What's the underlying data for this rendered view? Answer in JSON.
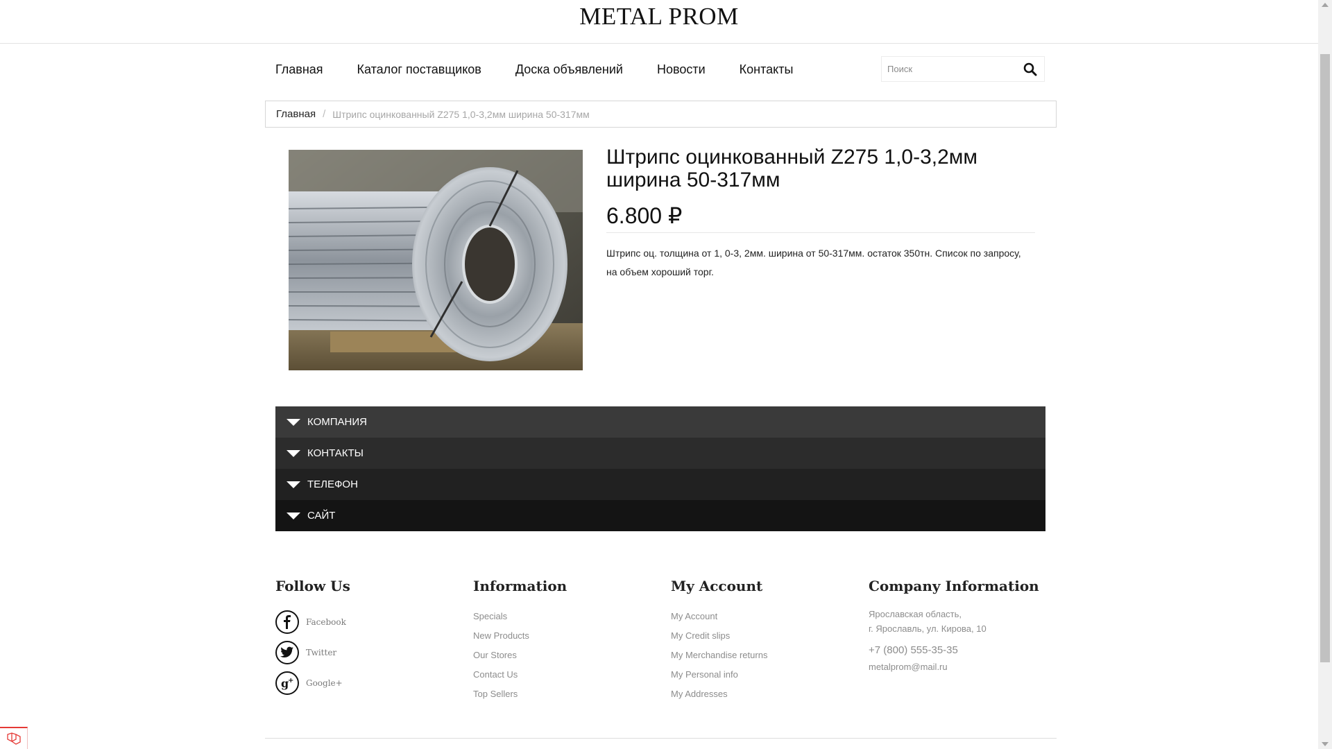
{
  "header": {
    "logo": "METAL PROM"
  },
  "nav": {
    "items": [
      {
        "label": "Главная"
      },
      {
        "label": "Каталог поставщиков"
      },
      {
        "label": "Доска объявлений"
      },
      {
        "label": "Новости"
      },
      {
        "label": "Контакты"
      }
    ]
  },
  "search": {
    "placeholder": "Поиск",
    "value": "",
    "icon": "search-icon"
  },
  "breadcrumb": {
    "home": "Главная",
    "separator": "/",
    "current": "Штрипс оцинкованный Z275 1,0-3,2мм ширина 50-317мм"
  },
  "product": {
    "title": "Штрипс оцинкованный Z275 1,0-3,2мм ширина 50-317мм",
    "price": "6.800 ₽",
    "description": "Штрипс оц. толщина от 1, 0-3, 2мм. ширина от 50-317мм. остаток 350тн. Список по запросу, на объем хороший торг.",
    "image_alt": "steel-coils-photo"
  },
  "accordion": {
    "items": [
      {
        "label": "КОМПАНИЯ"
      },
      {
        "label": "КОНТАКТЫ"
      },
      {
        "label": "ТЕЛЕФОН"
      },
      {
        "label": "САЙТ"
      }
    ]
  },
  "footer": {
    "follow": {
      "heading": "Follow Us",
      "items": [
        {
          "label": "Facebook",
          "icon": "facebook-icon"
        },
        {
          "label": "Twitter",
          "icon": "twitter-icon"
        },
        {
          "label": "Google+",
          "icon": "google-plus-icon"
        }
      ]
    },
    "information": {
      "heading": "Information",
      "links": [
        "Specials",
        "New Products",
        "Our Stores",
        "Contact Us",
        "Top Sellers"
      ]
    },
    "account": {
      "heading": "My Account",
      "links": [
        "My Account",
        "My Credit slips",
        "My Merchandise returns",
        "My Personal info",
        "My Addresses"
      ]
    },
    "company": {
      "heading": "Company Information",
      "address_line1": "Ярославская область,",
      "address_line2": "г. Ярославль, ул. Кирова, 10",
      "phone": "+7 (800) 555-35-35",
      "email": "metalprom@mail.ru"
    }
  },
  "colors": {
    "accordion_1": "#3a3a3a",
    "accordion_2": "#2c2c2c",
    "accordion_3": "#212121",
    "accordion_4": "#141414",
    "footer_text": "#8c8c8c",
    "widget_accent": "#e53935"
  }
}
